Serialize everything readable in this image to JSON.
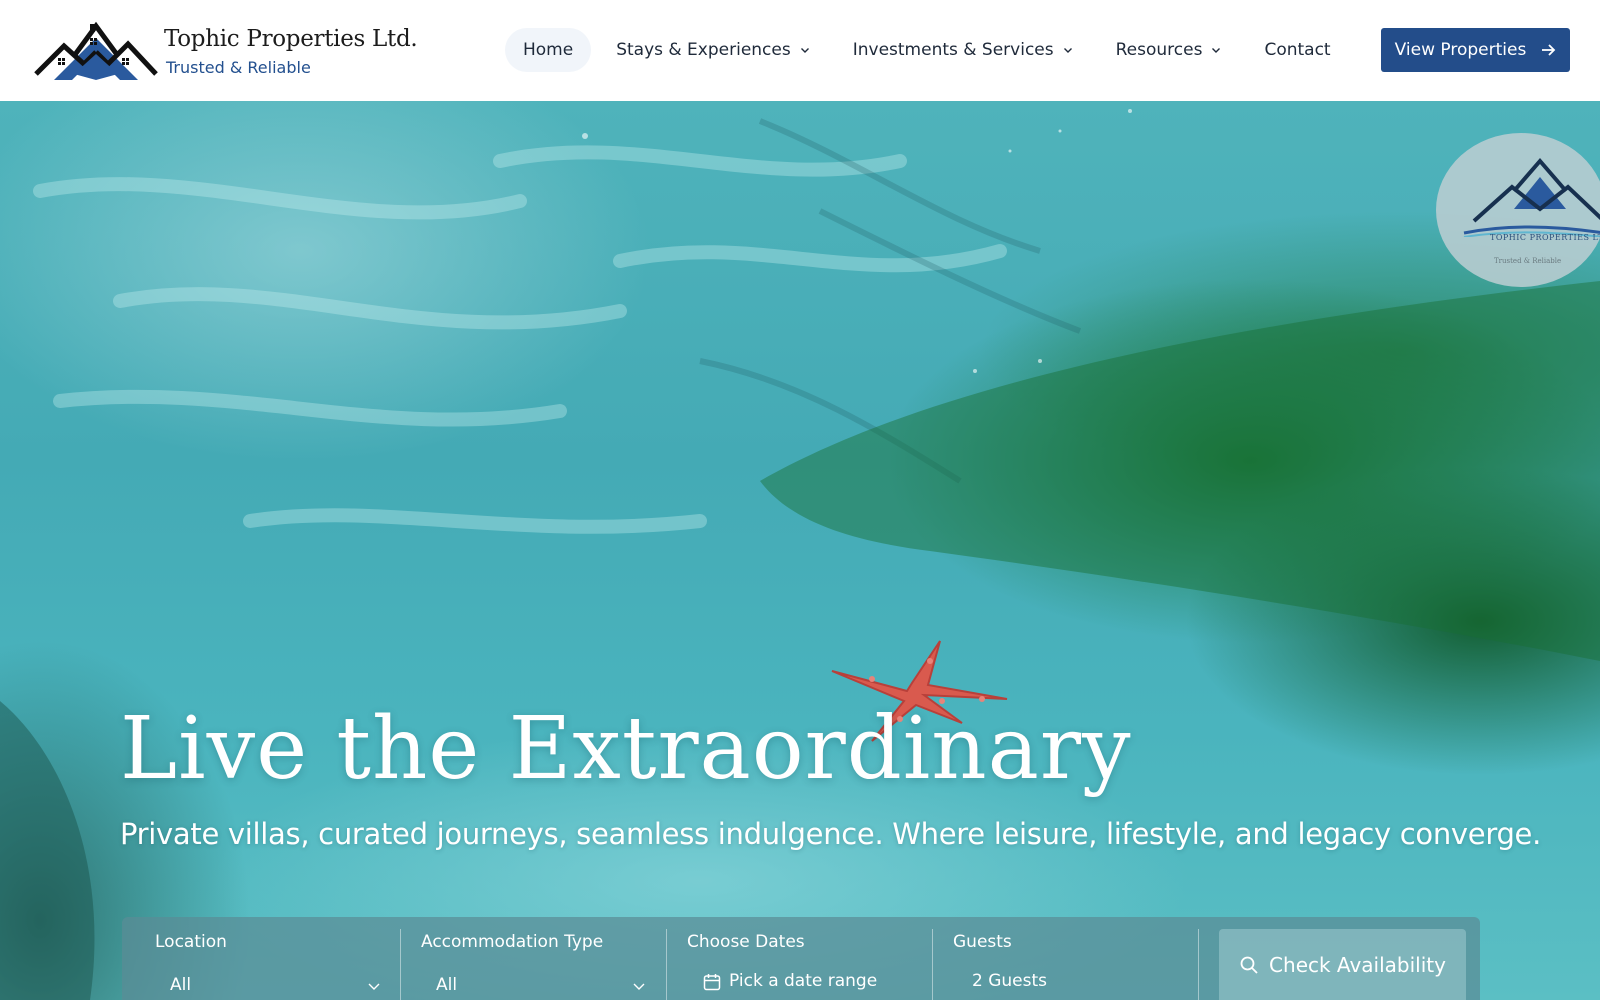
{
  "header": {
    "brand_name": "Tophic Properties Ltd.",
    "brand_tagline": "Trusted & Reliable",
    "nav": [
      {
        "label": "Home",
        "active": true,
        "has_dropdown": false
      },
      {
        "label": "Stays & Experiences",
        "active": false,
        "has_dropdown": true
      },
      {
        "label": "Investments & Services",
        "active": false,
        "has_dropdown": true
      },
      {
        "label": "Resources",
        "active": false,
        "has_dropdown": true
      },
      {
        "label": "Contact",
        "active": false,
        "has_dropdown": false
      }
    ],
    "cta_label": "View Properties",
    "cta_icon": "arrow-right-icon"
  },
  "hero": {
    "title": "Live the Extraordinary",
    "subtitle": "Private villas, curated journeys, seamless indulgence. Where leisure, lifestyle, and legacy converge.",
    "badge_name": "TOPHIC PROPERTIES LTD",
    "badge_tagline": "Trusted & Reliable"
  },
  "booking": {
    "location": {
      "label": "Location",
      "value": "All"
    },
    "accommodation": {
      "label": "Accommodation Type",
      "value": "All"
    },
    "dates": {
      "label": "Choose Dates",
      "placeholder": "Pick a date range",
      "icon": "calendar-icon"
    },
    "guests": {
      "label": "Guests",
      "value": "2 Guests"
    },
    "submit_label": "Check Availability",
    "submit_icon": "search-icon"
  },
  "colors": {
    "brand_blue": "#234d8a",
    "nav_text": "#1f2a3a",
    "header_bg": "#ffffff",
    "water": "#44aab5"
  }
}
